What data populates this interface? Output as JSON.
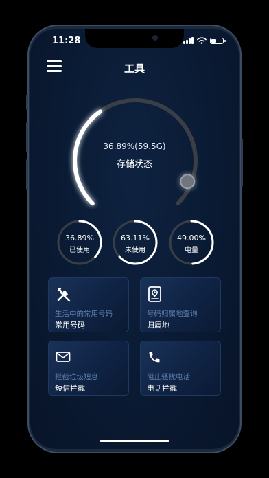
{
  "status_bar": {
    "time": "11:28"
  },
  "header": {
    "title": "工具"
  },
  "storage": {
    "percent_text": "36.89%(59.5G)",
    "label": "存储状态",
    "fraction": 0.3689
  },
  "stats": [
    {
      "percent_text": "36.89%",
      "label": "已使用",
      "fraction": 0.3689
    },
    {
      "percent_text": "63.11%",
      "label": "未使用",
      "fraction": 0.6311
    },
    {
      "percent_text": "49.00%",
      "label": "电量",
      "fraction": 0.49
    }
  ],
  "tools": [
    {
      "icon": "tools-icon",
      "desc": "生活中的常用号码",
      "name": "常用号码"
    },
    {
      "icon": "location-icon",
      "desc": "号码归属地查询",
      "name": "归属地"
    },
    {
      "icon": "mail-icon",
      "desc": "拦截垃圾短息",
      "name": "短信拦截"
    },
    {
      "icon": "phone-icon",
      "desc": "阻止骚扰电话",
      "name": "电话拦截"
    }
  ],
  "colors": {
    "accent": "#ffffff",
    "background": "#0a1a33",
    "card": "#13294b",
    "track": "#3a3f47"
  }
}
